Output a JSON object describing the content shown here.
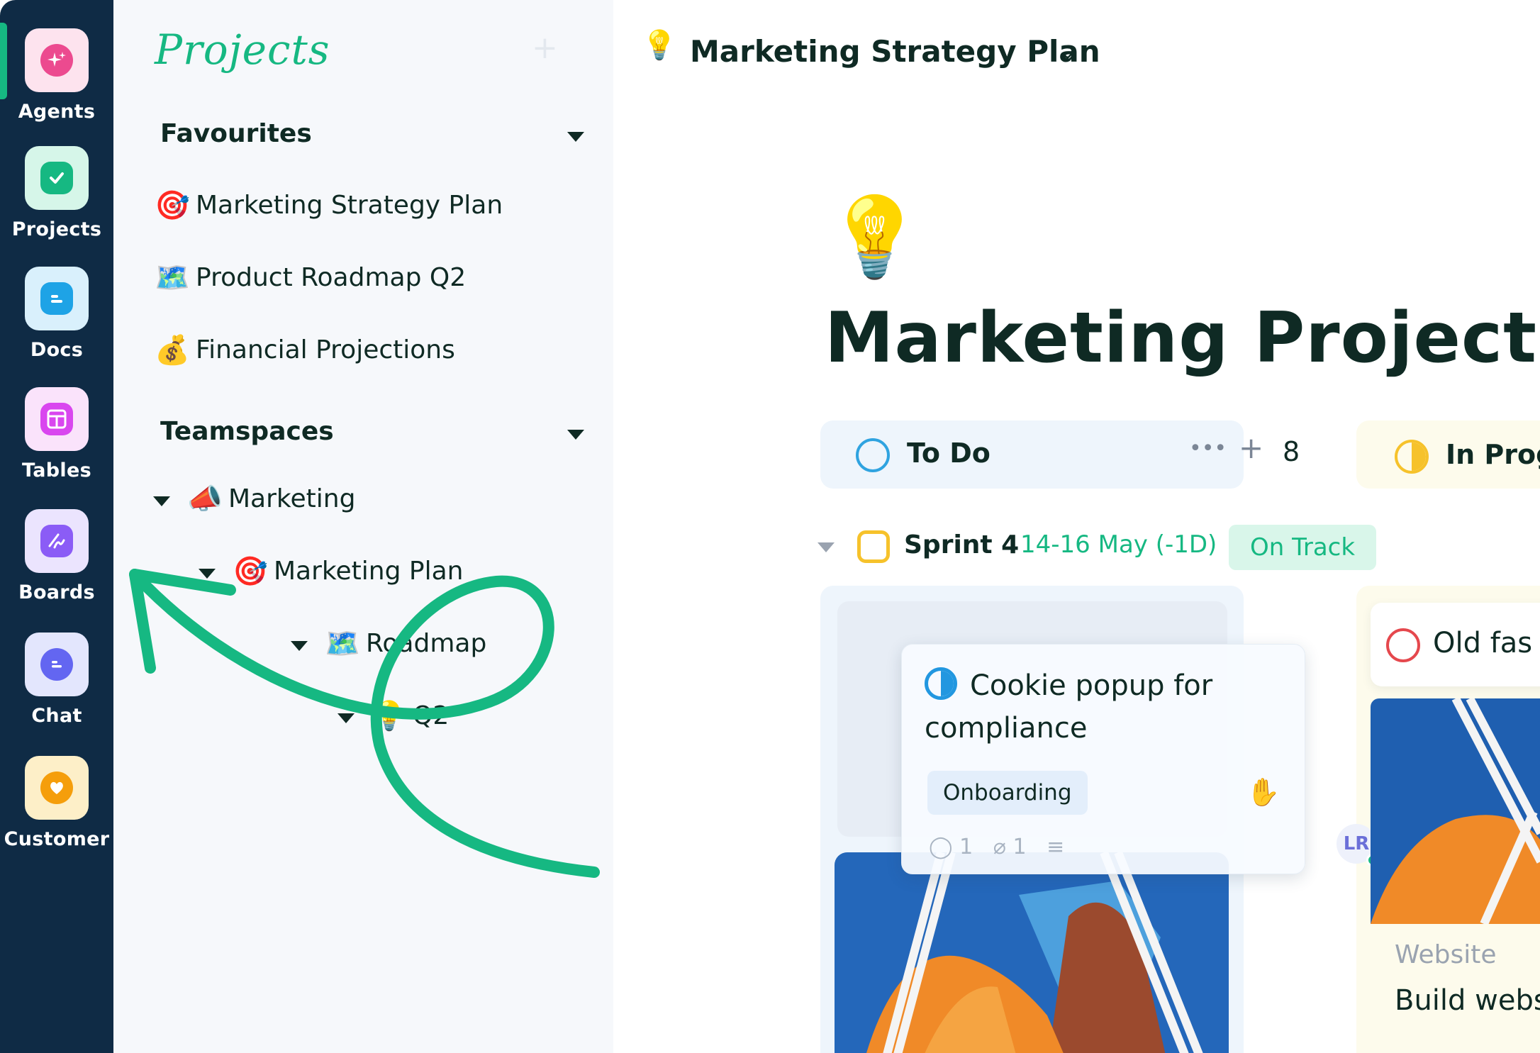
{
  "rail": {
    "items": [
      {
        "label": "Agents",
        "icon": "sparkle-icon",
        "color": "#ec4a8f"
      },
      {
        "label": "Projects",
        "icon": "check-icon",
        "color": "#16b882"
      },
      {
        "label": "Docs",
        "icon": "doc-icon",
        "color": "#1ea3e6"
      },
      {
        "label": "Tables",
        "icon": "table-icon",
        "color": "#d946ef"
      },
      {
        "label": "Boards",
        "icon": "pen-icon",
        "color": "#8b5cf6"
      },
      {
        "label": "Chat",
        "icon": "chat-icon",
        "color": "#6366f1"
      },
      {
        "label": "Customer",
        "icon": "heart-icon",
        "color": "#f59e0b"
      }
    ]
  },
  "sidebar": {
    "title": "Projects",
    "favourites_label": "Favourites",
    "favourites": [
      {
        "emoji": "🎯",
        "label": "Marketing Strategy Plan"
      },
      {
        "emoji": "🗺️",
        "label": "Product Roadmap Q2"
      },
      {
        "emoji": "💰",
        "label": "Financial Projections"
      }
    ],
    "teamspaces_label": "Teamspaces",
    "tree": [
      {
        "emoji": "📣",
        "label": "Marketing"
      },
      {
        "emoji": "🎯",
        "label": "Marketing Plan"
      },
      {
        "emoji": "🗺️",
        "label": "Roadmap"
      },
      {
        "emoji": "💡",
        "label": "Q2"
      }
    ]
  },
  "main": {
    "breadcrumb_emoji": "💡",
    "breadcrumb_title": "Marketing Strategy Plan",
    "page_emoji": "💡",
    "page_title": "Marketing Project",
    "columns": [
      {
        "label": "To Do",
        "more": "•••",
        "add": "+",
        "count": "8"
      },
      {
        "label": "In Prog"
      }
    ],
    "sprint": {
      "name": "Sprint 4",
      "dates": "14-16 May (-1D)",
      "status": "On Track"
    },
    "task_card": {
      "title": "Cookie popup for compliance",
      "tag": "Onboarding",
      "comments": "1",
      "attachments": "1",
      "assignee_initials": "LR"
    },
    "prog_card": {
      "title": "Old fas"
    },
    "prog_card2": {
      "category": "Website",
      "title": "Build webs campaign"
    }
  },
  "colors": {
    "rail_bg": "#0f2b45",
    "accent_green": "#16b882",
    "text_dark": "#0f2a24",
    "todo_ring": "#2fa3e0",
    "progress_ring": "#f6c22b",
    "red_ring": "#e5484d"
  }
}
